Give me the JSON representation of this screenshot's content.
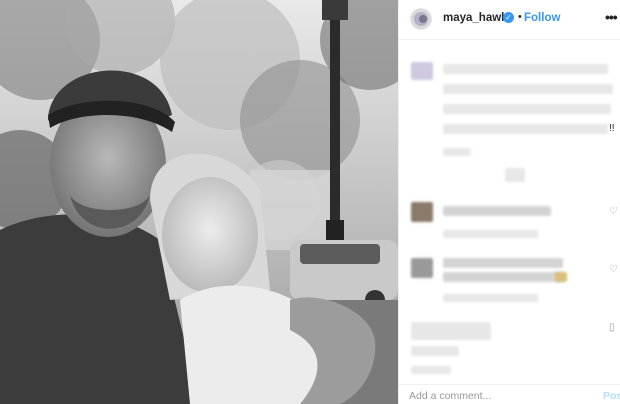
{
  "header": {
    "username": "maya_hawke",
    "verified_icon": "check-icon",
    "separator": "•",
    "follow_label": "Follow",
    "more_icon": "more-options-icon",
    "more_glyph": "•••"
  },
  "caption": {
    "visible_text": "!!"
  },
  "comment_box": {
    "placeholder": "Add a comment...",
    "post_label": "Pos"
  },
  "colors": {
    "accent": "#3897f0",
    "post_button_disabled": "#b2dffc",
    "text": "#262626",
    "muted": "#999999"
  }
}
